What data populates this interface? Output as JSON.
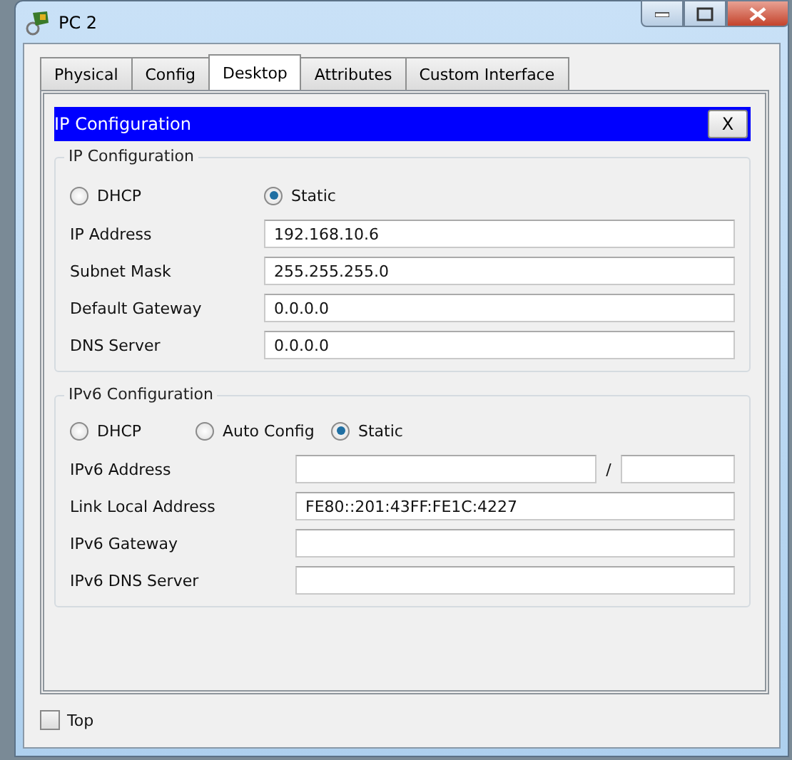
{
  "window": {
    "title": "PC 2"
  },
  "tabs": [
    {
      "label": "Physical",
      "selected": false
    },
    {
      "label": "Config",
      "selected": false
    },
    {
      "label": "Desktop",
      "selected": true
    },
    {
      "label": "Attributes",
      "selected": false
    },
    {
      "label": "Custom Interface",
      "selected": false
    }
  ],
  "dialog": {
    "title": "IP Configuration",
    "close": "X"
  },
  "ipv4": {
    "title": "IP Configuration",
    "modes": [
      {
        "label": "DHCP",
        "selected": false
      },
      {
        "label": "Static",
        "selected": true
      }
    ],
    "fields": [
      {
        "label": "IP Address",
        "value": "192.168.10.6"
      },
      {
        "label": "Subnet Mask",
        "value": "255.255.255.0"
      },
      {
        "label": "Default Gateway",
        "value": "0.0.0.0"
      },
      {
        "label": "DNS Server",
        "value": "0.0.0.0"
      }
    ]
  },
  "ipv6": {
    "title": "IPv6 Configuration",
    "modes": [
      {
        "label": "DHCP",
        "selected": false
      },
      {
        "label": "Auto Config",
        "selected": false
      },
      {
        "label": "Static",
        "selected": true
      }
    ],
    "fields": [
      {
        "label": "IPv6 Address",
        "kind": "split",
        "separator": "/"
      },
      {
        "label": "Link Local Address",
        "kind": "single",
        "value": "FE80::201:43FF:FE1C:4227"
      },
      {
        "label": "IPv6 Gateway",
        "kind": "single"
      },
      {
        "label": "IPv6 DNS Server",
        "kind": "single"
      }
    ]
  },
  "top_option": {
    "label": "Top",
    "checked": false
  }
}
